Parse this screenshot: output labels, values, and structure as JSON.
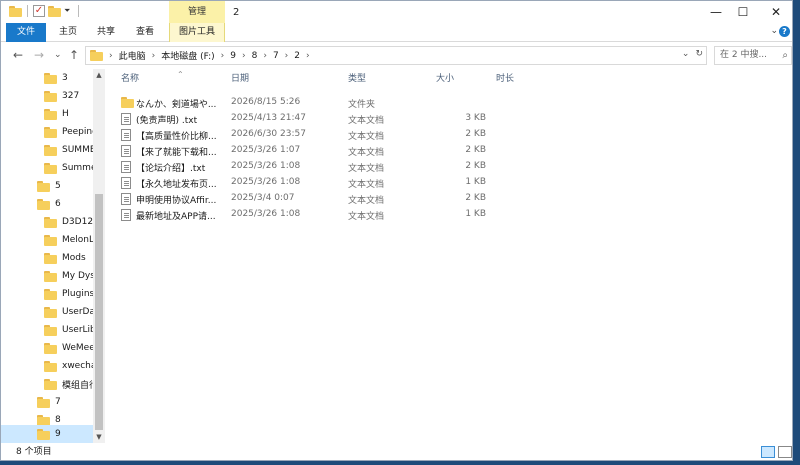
{
  "titlebar": {
    "title": "2",
    "context_tab_group": "管理",
    "minimize": "—",
    "maximize": "☐",
    "close": "✕"
  },
  "ribbon": {
    "tabs": [
      "文件",
      "主页",
      "共享",
      "查看",
      "图片工具"
    ],
    "expand": "⌄",
    "help": "?"
  },
  "nav": {
    "back": "←",
    "forward": "→",
    "recent": "⌄",
    "up": "↑",
    "breadcrumb": [
      "此电脑",
      "本地磁盘 (F:)",
      "9",
      "8",
      "7",
      "2"
    ],
    "dropdown": "⌄",
    "refresh": "↻"
  },
  "search": {
    "placeholder": "在 2 中搜..."
  },
  "navpane": {
    "items": [
      {
        "label": "3",
        "indent": 2
      },
      {
        "label": "327",
        "indent": 2
      },
      {
        "label": "H",
        "indent": 2
      },
      {
        "label": "Peeping",
        "indent": 2
      },
      {
        "label": "SUMME",
        "indent": 2
      },
      {
        "label": "Summer",
        "indent": 2
      },
      {
        "label": "5",
        "indent": 1
      },
      {
        "label": "6",
        "indent": 1
      },
      {
        "label": "D3D12",
        "indent": 2
      },
      {
        "label": "MelonLo",
        "indent": 2
      },
      {
        "label": "Mods",
        "indent": 2
      },
      {
        "label": "My Dyst",
        "indent": 2
      },
      {
        "label": "Plugins",
        "indent": 2
      },
      {
        "label": "UserDat",
        "indent": 2
      },
      {
        "label": "UserLibs",
        "indent": 2
      },
      {
        "label": "WeMeet",
        "indent": 2
      },
      {
        "label": "xwechat",
        "indent": 2
      },
      {
        "label": "模组自行",
        "indent": 2
      },
      {
        "label": "7",
        "indent": 1
      },
      {
        "label": "8",
        "indent": 1
      },
      {
        "label": "9",
        "indent": 1,
        "selected": true
      }
    ]
  },
  "filelist": {
    "columns": [
      "名称",
      "日期",
      "类型",
      "大小",
      "时长"
    ],
    "rows": [
      {
        "name": "なんか、剣道場や...",
        "date": "2026/8/15 5:26",
        "type": "文件夹",
        "size": "",
        "icon": "folder-icon"
      },
      {
        "name": "(免责声明) .txt",
        "date": "2025/4/13 21:47",
        "type": "文本文档",
        "size": "3 KB",
        "icon": "text-file-icon"
      },
      {
        "name": "【高质量性价比柳...",
        "date": "2026/6/30 23:57",
        "type": "文本文档",
        "size": "2 KB",
        "icon": "text-file-icon"
      },
      {
        "name": "【来了就能下载和...",
        "date": "2025/3/26 1:07",
        "type": "文本文档",
        "size": "2 KB",
        "icon": "text-file-icon"
      },
      {
        "name": "【论坛介绍】.txt",
        "date": "2025/3/26 1:08",
        "type": "文本文档",
        "size": "2 KB",
        "icon": "text-file-icon"
      },
      {
        "name": "【永久地址发布页...",
        "date": "2025/3/26 1:08",
        "type": "文本文档",
        "size": "1 KB",
        "icon": "text-file-icon"
      },
      {
        "name": "申明使用协议Affir...",
        "date": "2025/3/4 0:07",
        "type": "文本文档",
        "size": "2 KB",
        "icon": "text-file-icon"
      },
      {
        "name": "最新地址及APP请...",
        "date": "2025/3/26 1:08",
        "type": "文本文档",
        "size": "1 KB",
        "icon": "text-file-icon"
      }
    ]
  },
  "status": {
    "count": "8 个项目"
  },
  "colors": {
    "accent": "#1979ca",
    "selection": "#cce8ff",
    "context_tab": "#fbf1a8",
    "folder": "#f6cf5c"
  }
}
